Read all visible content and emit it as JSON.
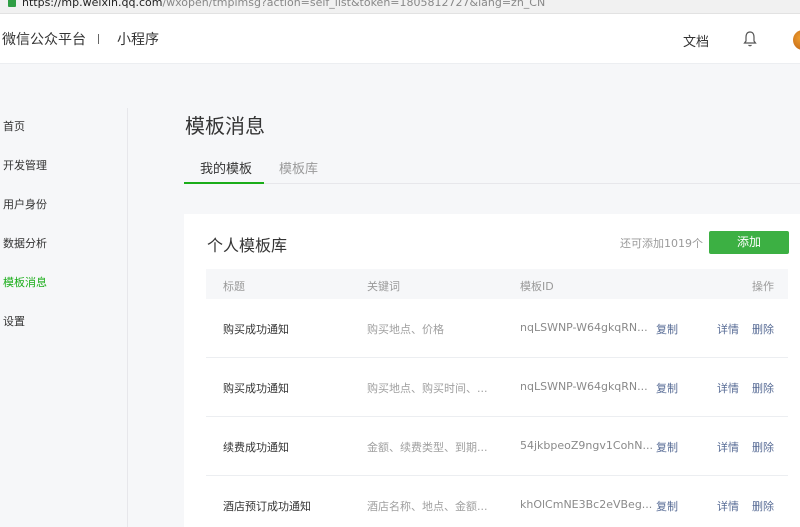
{
  "browser": {
    "url_host": "https://mp.weixin.qq.com",
    "url_path": "/wxopen/tmplmsg?action=self_list&token=1805812727&lang=zh_CN"
  },
  "header": {
    "brand": "微信公众平台",
    "section": "小程序",
    "docs_link": "文档"
  },
  "sidebar": {
    "items": [
      {
        "label": "首页"
      },
      {
        "label": "开发管理"
      },
      {
        "label": "用户身份"
      },
      {
        "label": "数据分析"
      },
      {
        "label": "模板消息",
        "active": true
      },
      {
        "label": "设置"
      }
    ]
  },
  "main": {
    "title": "模板消息",
    "tabs": [
      {
        "label": "我的模板",
        "active": true
      },
      {
        "label": "模板库"
      }
    ],
    "card": {
      "title": "个人模板库",
      "quota_text": "还可添加1019个",
      "add_button": "添加",
      "columns": [
        "标题",
        "关键词",
        "模板ID",
        "操作"
      ],
      "rows": [
        {
          "title": "购买成功通知",
          "keywords": "购买地点、价格",
          "template_id": "nqLSWNP-W64gkqRN...",
          "copy": "复制",
          "detail": "详情",
          "delete": "删除"
        },
        {
          "title": "购买成功通知",
          "keywords": "购买地点、购买时间、...",
          "template_id": "nqLSWNP-W64gkqRN...",
          "copy": "复制",
          "detail": "详情",
          "delete": "删除"
        },
        {
          "title": "续费成功通知",
          "keywords": "金额、续费类型、到期...",
          "template_id": "54jkbpeoZ9ngv1CohN...",
          "copy": "复制",
          "detail": "详情",
          "delete": "删除"
        },
        {
          "title": "酒店预订成功通知",
          "keywords": "酒店名称、地点、金额...",
          "template_id": "khOlCmNE3Bc2eVBeg...",
          "copy": "复制",
          "detail": "详情",
          "delete": "删除"
        }
      ]
    }
  },
  "colors": {
    "accent": "#1aad19",
    "button": "#3cb043",
    "link": "#576b95"
  }
}
